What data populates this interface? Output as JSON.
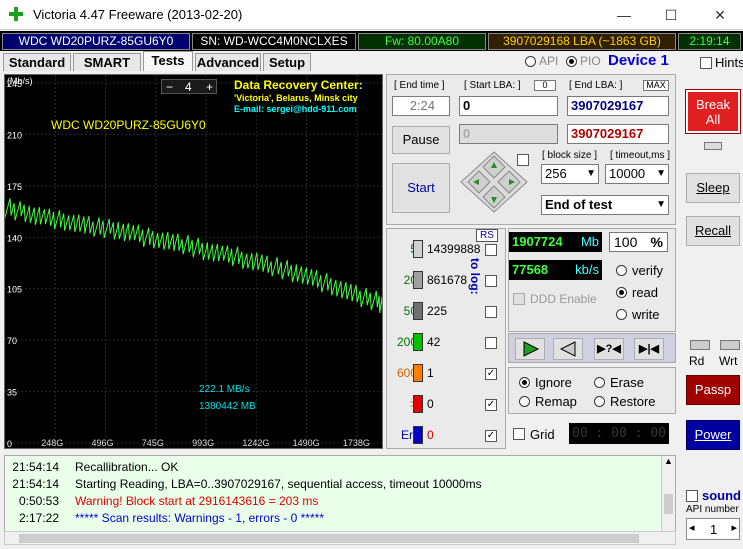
{
  "window": {
    "title": "Victoria 4.47  Freeware (2013-02-20)",
    "minimize_glyph": "—",
    "maximize_glyph": "☐",
    "close_glyph": "✕"
  },
  "infobar": {
    "model": "WDC WD20PURZ-85GU6Y0",
    "serial": "SN: WD-WCC4M0NCLXES",
    "firmware": "Fw: 80.00A80",
    "lba": "3907029168 LBA (~1863 GB)",
    "clock": "2:19:14"
  },
  "tabs": [
    "Standard",
    "SMART",
    "Tests",
    "Advanced",
    "Setup"
  ],
  "api": {
    "api_label": "API",
    "pio_label": "PIO",
    "device": "Device 1",
    "hints": "Hints"
  },
  "chart_data": {
    "type": "line",
    "title": "WDC WD20PURZ-85GU6Y0",
    "ylabel_unit": "(Mb/s)",
    "y_ticks": [
      "245",
      "210",
      "175",
      "140",
      "105",
      "70",
      "35",
      "0"
    ],
    "x_ticks": [
      "248G",
      "496G",
      "745G",
      "993G",
      "1242G",
      "1490G",
      "1738G"
    ],
    "ylim": [
      0,
      245
    ],
    "xlim": [
      0,
      1863
    ],
    "grid": true,
    "speed_readout": "222.1 MB/s",
    "position_readout": "1380442 MB",
    "legend_stepper": "4",
    "recovery": {
      "line1": "Data Recovery Center:",
      "line2": "'Victoria', Belarus, Minsk city",
      "line3": "E-mail: sergei@hdd-911.com"
    },
    "series": [
      {
        "x": [
          0,
          40,
          80,
          120,
          160,
          200,
          240,
          280,
          320,
          360,
          400,
          440,
          480,
          520,
          560,
          600,
          640,
          680,
          720,
          760,
          800,
          840,
          880,
          920,
          960,
          1000,
          1040,
          1080,
          1120,
          1160,
          1200,
          1240,
          1280,
          1320,
          1360,
          1400,
          1440,
          1480,
          1520,
          1560,
          1600,
          1640,
          1680,
          1720,
          1760,
          1800,
          1840,
          1863
        ],
        "y": [
          160,
          158,
          157,
          155,
          154,
          153,
          152,
          151,
          150,
          149,
          148,
          147,
          146,
          145,
          144,
          143,
          142,
          140,
          139,
          138,
          137,
          136,
          135,
          133,
          131,
          130,
          129,
          128,
          127,
          125,
          124,
          123,
          121,
          120,
          118,
          116,
          115,
          113,
          111,
          109,
          107,
          105,
          103,
          101,
          99,
          97,
          95,
          93
        ]
      }
    ]
  },
  "controls": {
    "end_time_label": "[ End time ]",
    "end_time_value": "2:24",
    "start_lba_label": "[ Start LBA: ]",
    "start_lba_zero": "0",
    "start_lba_value": "0",
    "start_lba_current": "0",
    "end_lba_label": "[ End LBA: ]",
    "end_lba_max": "MAX",
    "end_lba_value": "3907029167",
    "end_lba_current": "3907029167",
    "pause": "Pause",
    "start": "Start",
    "block_size_label": "[ block size ]",
    "block_size": "256",
    "timeout_label": "[ timeout,ms ]",
    "timeout": "10000",
    "end_action": "End of test",
    "rs": "RS",
    "to_log": "to log:"
  },
  "histogram": [
    {
      "ms": "5",
      "count": "14399888",
      "color": "#d0d0d0"
    },
    {
      "ms": "20",
      "count": "861678",
      "color": "#a0a0a0"
    },
    {
      "ms": "50",
      "count": "225",
      "color": "#707070"
    },
    {
      "ms": "200",
      "count": "42",
      "color": "#00c000"
    },
    {
      "ms": "600",
      "count": "1",
      "color": "#ff8000"
    },
    {
      "ms": ">",
      "count": "0",
      "color": "#e00000"
    },
    {
      "ms": "Err",
      "count": "0",
      "color": "#0000c0"
    }
  ],
  "stats": {
    "mb_value": "1907724",
    "mb_unit": "Mb",
    "percent": "100",
    "percent_unit": "%",
    "speed_value": "77568",
    "speed_unit": "kb/s",
    "ddd": "DDD Enable",
    "verify": "verify",
    "read": "read",
    "write": "write"
  },
  "actions": {
    "ignore": "Ignore",
    "erase": "Erase",
    "remap": "Remap",
    "restore": "Restore",
    "grid": "Grid",
    "grid_timer": "00 : 00 : 00"
  },
  "sidebar": {
    "break_all": "Break All",
    "sleep": "Sleep",
    "recall": "Recall",
    "rd": "Rd",
    "wrt": "Wrt",
    "passp": "Passp",
    "power": "Power",
    "sound": "sound",
    "api_number": "API number",
    "api_number_value": "1"
  },
  "log": [
    {
      "time": "21:54:14",
      "msg": "Recallibration... OK",
      "color": "#000000"
    },
    {
      "time": "21:54:14",
      "msg": "Starting Reading, LBA=0..3907029167, sequential access, timeout 10000ms",
      "color": "#000000"
    },
    {
      "time": "0:50:53",
      "msg": "Warning! Block start at 2916143616 = 203 ms",
      "color": "#e00000"
    },
    {
      "time": "2:17:22",
      "msg": "***** Scan results: Warnings - 1, errors - 0 *****",
      "color": "#0000d0"
    }
  ]
}
